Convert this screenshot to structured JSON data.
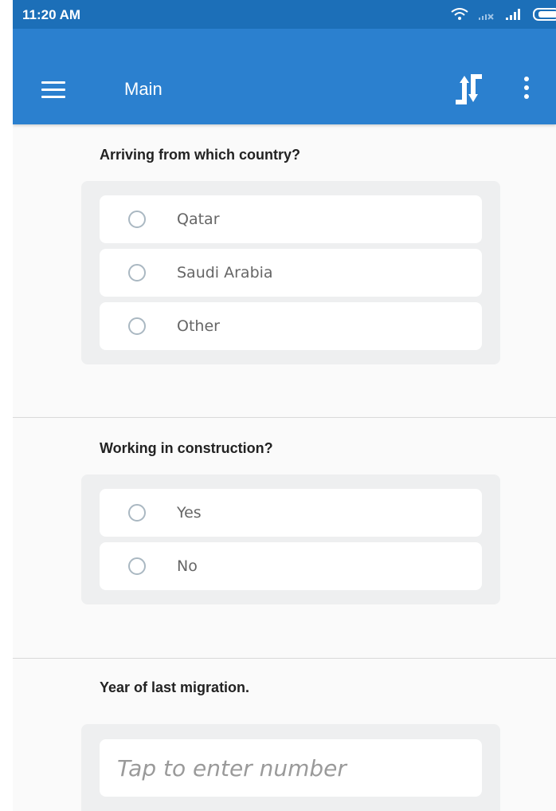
{
  "status_bar": {
    "time": "11:20 AM"
  },
  "app_bar": {
    "title": "Main",
    "icons": [
      "menu-icon",
      "sync-icon",
      "more-vert-icon"
    ]
  },
  "questions": [
    {
      "label": "Arriving from which country?",
      "type": "single-choice",
      "options": [
        "Qatar",
        "Saudi Arabia",
        "Other"
      ]
    },
    {
      "label": "Working in construction?",
      "type": "single-choice",
      "options": [
        "Yes",
        "No"
      ]
    },
    {
      "label": "Year of last migration.",
      "type": "number",
      "placeholder": "Tap to enter number"
    }
  ],
  "colors": {
    "status_bar": "#1c6fb8",
    "app_bar": "#2b80cf",
    "background": "#fafafa",
    "panel": "#eeeff0"
  }
}
